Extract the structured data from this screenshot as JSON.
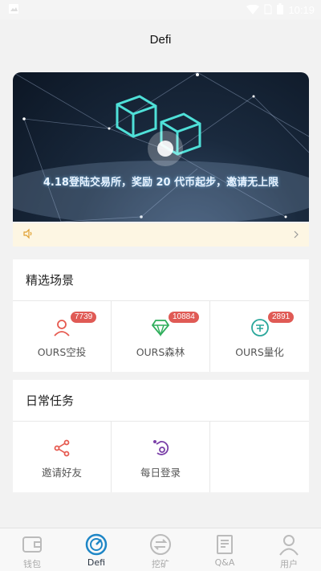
{
  "status_bar": {
    "time": "10:19"
  },
  "header": {
    "title": "Defi"
  },
  "banner": {
    "text": "4.18登陆交易所，奖励 20 代币起步，邀请无上限"
  },
  "featured": {
    "title": "精选场景",
    "items": [
      {
        "label": "OURS空投",
        "badge": "7739",
        "icon": "user-icon",
        "color": "#e65a50"
      },
      {
        "label": "OURS森林",
        "badge": "10884",
        "icon": "diamond-icon",
        "color": "#2fae5b"
      },
      {
        "label": "OURS量化",
        "badge": "2891",
        "icon": "coin-icon",
        "color": "#2aa79b"
      }
    ]
  },
  "daily": {
    "title": "日常任务",
    "items": [
      {
        "label": "邀请好友",
        "icon": "share-icon",
        "color": "#e65a50"
      },
      {
        "label": "每日登录",
        "icon": "login-icon",
        "color": "#7a3fa8"
      }
    ]
  },
  "tabbar": {
    "items": [
      {
        "label": "钱包",
        "icon": "wallet-icon",
        "active": false
      },
      {
        "label": "Defi",
        "icon": "defi-icon",
        "active": true
      },
      {
        "label": "挖矿",
        "icon": "exchange-icon",
        "active": false
      },
      {
        "label": "Q&A",
        "icon": "document-icon",
        "active": false
      },
      {
        "label": "用户",
        "icon": "person-icon",
        "active": false
      }
    ]
  },
  "colors": {
    "accent": "#1e86c6",
    "badge": "#e05a55",
    "notice_bg": "#fdf6e3"
  }
}
